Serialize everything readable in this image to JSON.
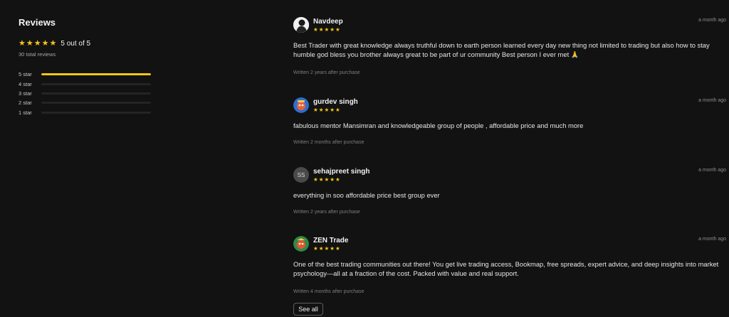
{
  "summary": {
    "title": "Reviews",
    "score_text": "5 out of 5",
    "total_text": "30 total reviews",
    "distribution": [
      {
        "label": "5 star",
        "fraction": 1.0
      },
      {
        "label": "4 star",
        "fraction": 0
      },
      {
        "label": "3 star",
        "fraction": 0
      },
      {
        "label": "2 star",
        "fraction": 0
      },
      {
        "label": "1 star",
        "fraction": 0
      }
    ]
  },
  "colors": {
    "star": "#f5c518",
    "background": "#121212",
    "bar_track": "#242424"
  },
  "reviews": [
    {
      "name": "Navdeep",
      "rating": 5,
      "time": "a month ago",
      "text": "Best Trader with great knowledge always truthful down to earth person learned every day new thing not limited to trading but also how to stay humble god bless you brother always great to be part of ur community Best person I ever met 🙏",
      "meta": "Written 2 years after purchase",
      "avatar_icon": "bw-portrait-avatar"
    },
    {
      "name": "gurdev singh",
      "rating": 5,
      "time": "a month ago",
      "text": "fabulous mentor Mansimran and knowledgeable group of people , affordable price and much more",
      "meta": "Written 2 months after purchase",
      "avatar_icon": "colorful-avatar"
    },
    {
      "name": "sehajpreet singh",
      "rating": 5,
      "time": "a month ago",
      "text": "everything in soo affordable price best group ever",
      "meta": "Written 2 years after purchase",
      "avatar_initials": "SS"
    },
    {
      "name": "ZEN Trade",
      "rating": 5,
      "time": "a month ago",
      "text": "One of the best trading communities out there! You get live trading access, Bookmap, free spreads, expert advice, and deep insights into market psychology—all at a fraction of the cost. Packed with value and real support.",
      "meta": "Written 4 months after purchase",
      "avatar_icon": "colorful-avatar"
    }
  ],
  "see_all_label": "See all"
}
